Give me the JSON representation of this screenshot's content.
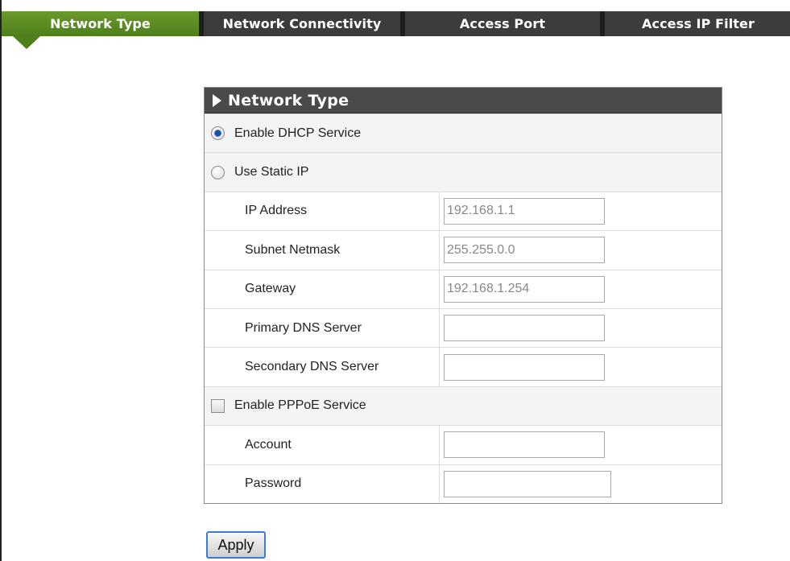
{
  "tabs": [
    {
      "label": "Network Type",
      "active": true
    },
    {
      "label": "Network Connectivity",
      "active": false
    },
    {
      "label": "Access Port",
      "active": false
    },
    {
      "label": "Access IP Filter",
      "active": false
    }
  ],
  "panel": {
    "title": "Network Type",
    "dhcp_label": "Enable DHCP Service",
    "dhcp_selected": true,
    "static_label": "Use Static IP",
    "static_selected": false,
    "fields": {
      "ip_address": {
        "label": "IP Address",
        "value": "192.168.1.1"
      },
      "subnet": {
        "label": "Subnet Netmask",
        "value": "255.255.0.0"
      },
      "gateway": {
        "label": "Gateway",
        "value": "192.168.1.254"
      },
      "primary_dns": {
        "label": "Primary DNS Server",
        "value": ""
      },
      "secondary_dns": {
        "label": "Secondary DNS Server",
        "value": ""
      }
    },
    "pppoe_label": "Enable PPPoE Service",
    "pppoe_checked": false,
    "pppoe_fields": {
      "account": {
        "label": "Account",
        "value": ""
      },
      "password": {
        "label": "Password",
        "value": ""
      }
    }
  },
  "apply_label": "Apply",
  "colors": {
    "tab_active": "#5a8a22",
    "tab_bar": "#3c3c3c",
    "panel_header": "#4a4a4a",
    "apply_border": "#3b7bd9"
  }
}
